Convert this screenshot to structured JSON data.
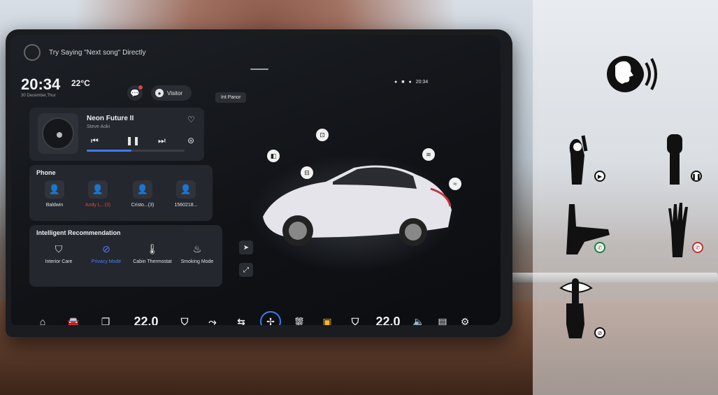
{
  "voice_hint": "Try Saying \"Next song\" Directly",
  "clock": {
    "time": "20:34",
    "temperature": "22°C",
    "date": "30 December,Thur"
  },
  "visitor_label": "Visitor",
  "music": {
    "title": "Neon Future II",
    "artist": "Steve Aoki",
    "progress": 0.46,
    "icons": {
      "favorite": "heart-icon",
      "previous": "skip-back-icon",
      "pause": "pause-icon",
      "next": "skip-forward-icon",
      "playlist": "list-icon"
    }
  },
  "phone": {
    "title": "Phone",
    "contacts": [
      {
        "name": "Baldwin",
        "missed": false
      },
      {
        "name": "Andy L...(3)",
        "missed": true
      },
      {
        "name": "Cristo...(3)",
        "missed": false
      },
      {
        "name": "1560218...",
        "missed": false
      }
    ]
  },
  "recommendation": {
    "title": "Intelligent Recommendation",
    "items": [
      {
        "label": "Interior Care",
        "active": false
      },
      {
        "label": "Privacy Mode",
        "active": true
      },
      {
        "label": "Cabin Thermostat",
        "active": false
      },
      {
        "label": "Smoking Mode",
        "active": false
      }
    ]
  },
  "status_bar": {
    "time": "20:34"
  },
  "view_button": "Int Panor",
  "dock": {
    "left_temp": "22.0",
    "right_temp": "22.0"
  },
  "colors": {
    "accent": "#3d7bf2",
    "alert": "#e0453b",
    "seat_heat": "#f2b62a"
  },
  "gestures": [
    {
      "name": "ok-hand-gesture",
      "action": "play-icon"
    },
    {
      "name": "fist-gesture",
      "action": "pause-icon"
    },
    {
      "name": "call-me-gesture",
      "action": "answer-call-icon"
    },
    {
      "name": "open-palm-gesture",
      "action": "hang-up-icon"
    },
    {
      "name": "shush-gesture",
      "action": "mute-icon"
    }
  ]
}
